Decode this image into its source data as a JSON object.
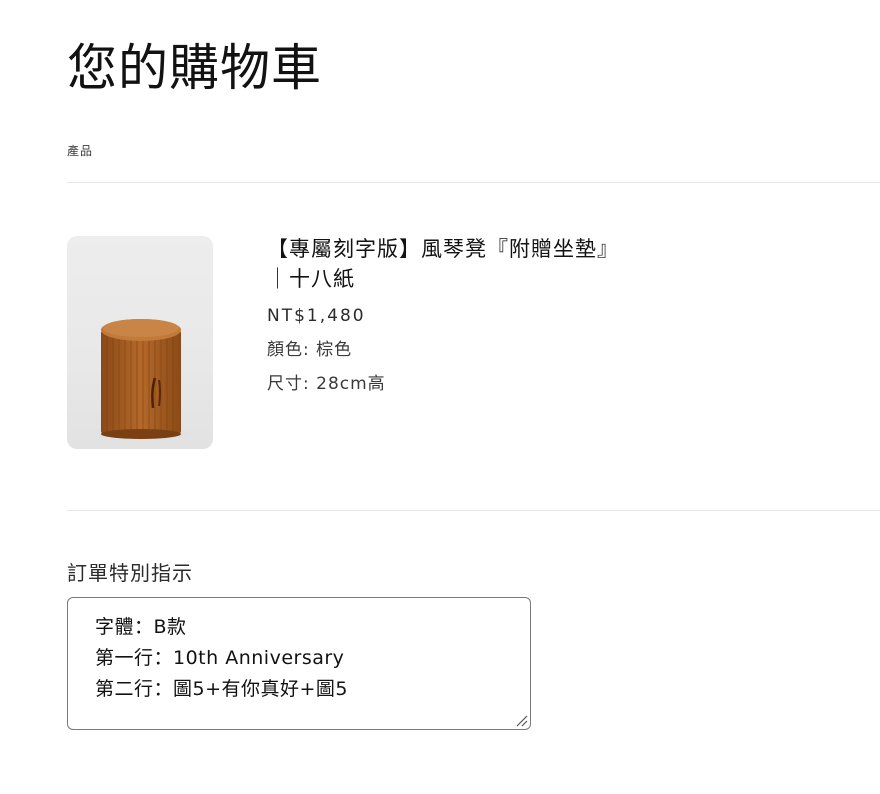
{
  "page": {
    "title": "您的購物車",
    "column_header": "產品"
  },
  "cart": {
    "items": [
      {
        "name_line1": "【專屬刻字版】風琴凳『附贈坐墊』",
        "name_line2": "｜十八紙",
        "price": "NT$1,480",
        "options": [
          "顏色: 棕色",
          "尺寸: 28cm高"
        ],
        "image_icon": "accordion-stool-image"
      }
    ]
  },
  "order_note": {
    "label": "訂單特別指示",
    "lines": [
      "字體：B款",
      "第一行：10th Anniversary",
      "第二行：圖5+有你真好+圖5"
    ]
  },
  "colors": {
    "text": "#121212",
    "divider": "#e6e6e6",
    "product_brown": "#b5692a"
  }
}
